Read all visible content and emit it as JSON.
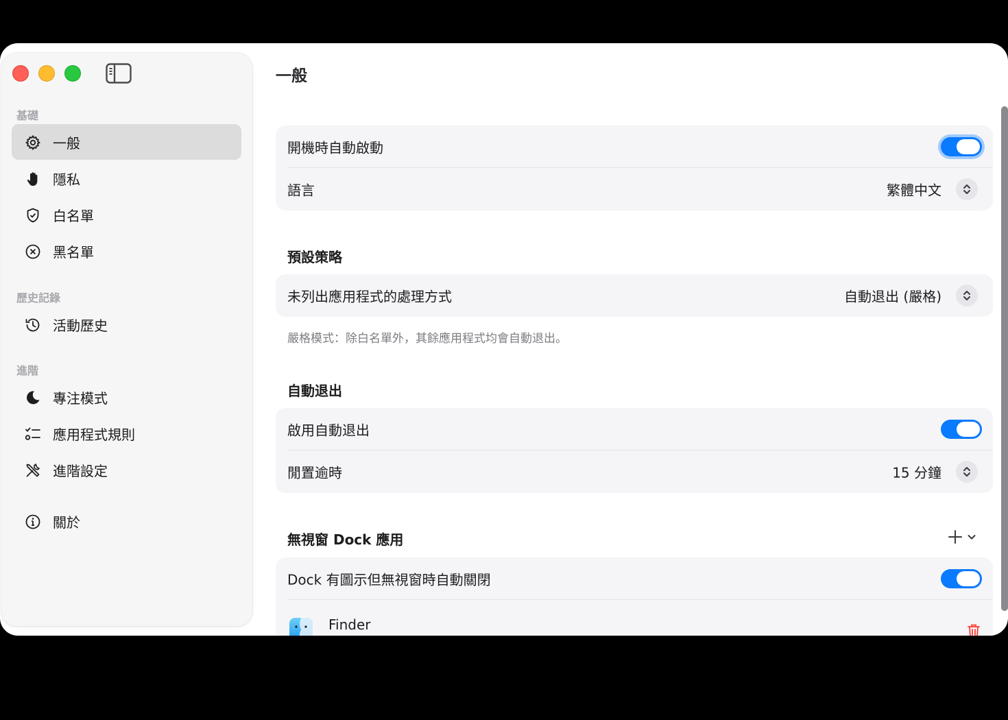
{
  "sidebar": {
    "sections": {
      "basics": "基礎",
      "history": "歷史記錄",
      "advanced": "進階"
    },
    "items": {
      "general": "一般",
      "privacy": "隱私",
      "whitelist": "白名單",
      "blacklist": "黑名單",
      "activity_history": "活動歷史",
      "focus_mode": "專注模式",
      "app_rules": "應用程式規則",
      "advanced_settings": "進階設定",
      "about": "關於"
    }
  },
  "main": {
    "title": "一般",
    "launch_at_login": {
      "label": "開機時自動啟動",
      "enabled": true
    },
    "language": {
      "label": "語言",
      "value": "繁體中文"
    },
    "default_policy": {
      "heading": "預設策略",
      "unlisted_label": "未列出應用程式的處理方式",
      "unlisted_value": "自動退出 (嚴格)",
      "footnote": "嚴格模式：除白名單外，其餘應用程式均會自動退出。"
    },
    "auto_quit": {
      "heading": "自動退出",
      "enable_label": "啟用自動退出",
      "enabled": true,
      "idle_label": "閒置逾時",
      "idle_value": "15 分鐘"
    },
    "windowless_dock": {
      "heading": "無視窗 Dock 應用",
      "close_label": "Dock 有圖示但無視窗時自動關閉",
      "enabled": true,
      "apps": [
        {
          "name": "Finder",
          "icon": "finder-icon"
        }
      ]
    }
  },
  "colors": {
    "accent": "#0a7aff",
    "traffic_red": "#fe5f57",
    "traffic_yellow": "#febc2e",
    "traffic_green": "#28c840",
    "danger": "#ff3b30"
  }
}
